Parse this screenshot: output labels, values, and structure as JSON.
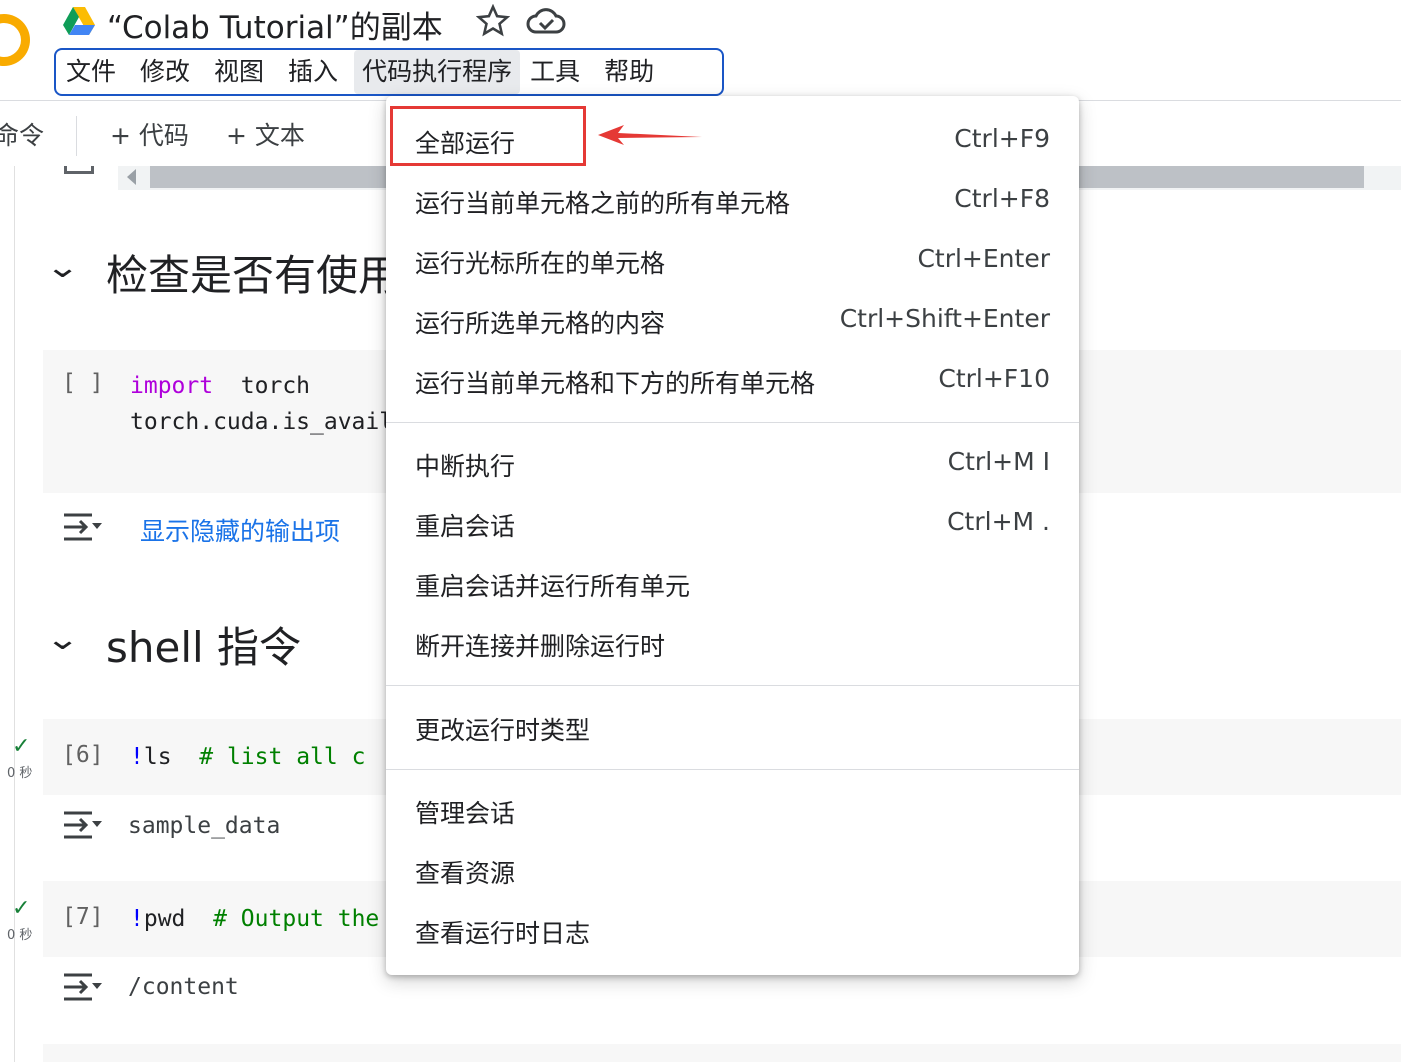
{
  "header": {
    "title": "“Colab Tutorial”的副本"
  },
  "menubar": {
    "items": [
      {
        "label": "文件"
      },
      {
        "label": "修改"
      },
      {
        "label": "视图"
      },
      {
        "label": "插入"
      },
      {
        "label": "代码执行程序"
      },
      {
        "label": "工具"
      },
      {
        "label": "帮助"
      }
    ],
    "active": "代码执行程序"
  },
  "toolbar": {
    "commands_label": "命令",
    "add_code_label": "+ 代码",
    "add_text_label": "+ 文本"
  },
  "notebook": {
    "section1_heading": "检查是否有使用",
    "cell1": {
      "prompt": "[ ]",
      "line1_kw": "import",
      "line1_rest": "torch",
      "line2": "torch.cuda.is_availa"
    },
    "cell1_output_link": "显示隐藏的输出项",
    "section2_heading": "shell 指令",
    "cell2": {
      "prompt": "[6]",
      "status_time": "0 秒",
      "code_bang": "!",
      "code_cmd": "ls",
      "comment": "#  list  all  c"
    },
    "cell2_output": "sample_data",
    "cell3": {
      "prompt": "[7]",
      "status_time": "0 秒",
      "code_bang": "!",
      "code_cmd": "pwd",
      "comment": "#  Output  the"
    },
    "cell3_output": "/content"
  },
  "dropdown": {
    "items": [
      {
        "label": "全部运行",
        "shortcut": "Ctrl+F9"
      },
      {
        "label": "运行当前单元格之前的所有单元格",
        "shortcut": "Ctrl+F8"
      },
      {
        "label": "运行光标所在的单元格",
        "shortcut": "Ctrl+Enter"
      },
      {
        "label": "运行所选单元格的内容",
        "shortcut": "Ctrl+Shift+Enter"
      },
      {
        "label": "运行当前单元格和下方的所有单元格",
        "shortcut": "Ctrl+F10"
      },
      {
        "label": "中断执行",
        "shortcut": "Ctrl+M I"
      },
      {
        "label": "重启会话",
        "shortcut": "Ctrl+M ."
      },
      {
        "label": "重启会话并运行所有单元",
        "shortcut": ""
      },
      {
        "label": "断开连接并删除运行时",
        "shortcut": ""
      },
      {
        "label": "更改运行时类型",
        "shortcut": ""
      },
      {
        "label": "管理会话",
        "shortcut": ""
      },
      {
        "label": "查看资源",
        "shortcut": ""
      },
      {
        "label": "查看运行时日志",
        "shortcut": ""
      }
    ]
  },
  "colors": {
    "highlight": "#e53935",
    "menubar_border": "#1a56c6",
    "link": "#1a73e8",
    "keyword": "#af00db",
    "comment": "#008000"
  }
}
